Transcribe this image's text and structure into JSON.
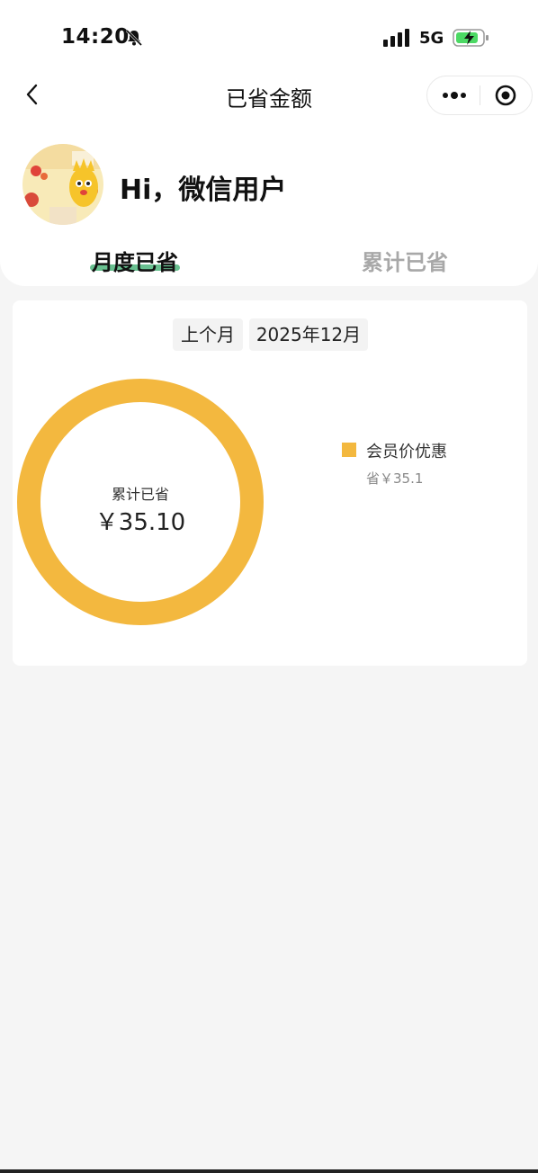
{
  "status_bar": {
    "time": "14:20",
    "network": "5G"
  },
  "nav": {
    "title": "已省金额"
  },
  "user": {
    "greeting": "Hi，微信用户"
  },
  "tabs": [
    {
      "label": "月度已省",
      "active": true
    },
    {
      "label": "累计已省",
      "active": false
    }
  ],
  "card": {
    "prev_label": "上个月",
    "date_label": "2025年12月",
    "donut_label": "累计已省",
    "donut_value": "￥35.10",
    "legend": [
      {
        "name": "会员价优惠",
        "value": "省￥35.1",
        "color": "#f3b83f"
      }
    ]
  },
  "chart_data": {
    "type": "pie",
    "categories": [
      "会员价优惠"
    ],
    "values": [
      35.1
    ]
  },
  "colors": {
    "accent": "#f3b83f",
    "tab_underline": "#4fb57d",
    "background": "#f5f5f5"
  }
}
